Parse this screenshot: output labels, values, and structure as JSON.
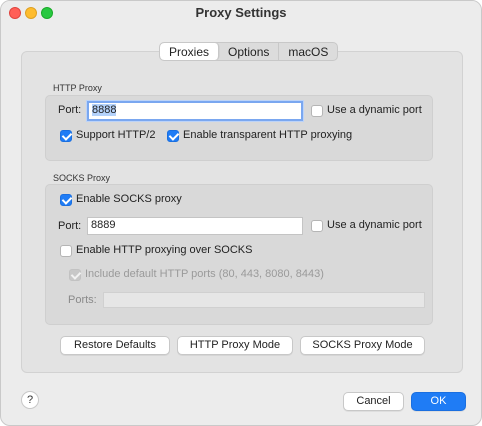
{
  "window": {
    "title": "Proxy Settings"
  },
  "tabs": [
    {
      "label": "Proxies",
      "active": true
    },
    {
      "label": "Options",
      "active": false
    },
    {
      "label": "macOS",
      "active": false
    }
  ],
  "http_proxy": {
    "group_label": "HTTP Proxy",
    "port_label": "Port:",
    "port_value": "8888",
    "dynamic_port_label": "Use a dynamic port",
    "dynamic_port_checked": false,
    "support_http2_label": "Support HTTP/2",
    "support_http2_checked": true,
    "transparent_label": "Enable transparent HTTP proxying",
    "transparent_checked": true
  },
  "socks_proxy": {
    "group_label": "SOCKS Proxy",
    "enable_label": "Enable SOCKS proxy",
    "enable_checked": true,
    "port_label": "Port:",
    "port_value": "8889",
    "dynamic_port_label": "Use a dynamic port",
    "dynamic_port_checked": false,
    "http_over_socks_label": "Enable HTTP proxying over SOCKS",
    "http_over_socks_checked": false,
    "include_default_ports_label": "Include default HTTP ports (80, 443, 8080, 8443)",
    "include_default_ports_checked": true,
    "ports_label": "Ports:",
    "ports_value": ""
  },
  "actions": {
    "restore_defaults": "Restore Defaults",
    "http_proxy_mode": "HTTP Proxy Mode",
    "socks_proxy_mode": "SOCKS Proxy Mode"
  },
  "footer": {
    "help": "?",
    "cancel": "Cancel",
    "ok": "OK"
  },
  "colors": {
    "accent": "#1f7cf5"
  }
}
